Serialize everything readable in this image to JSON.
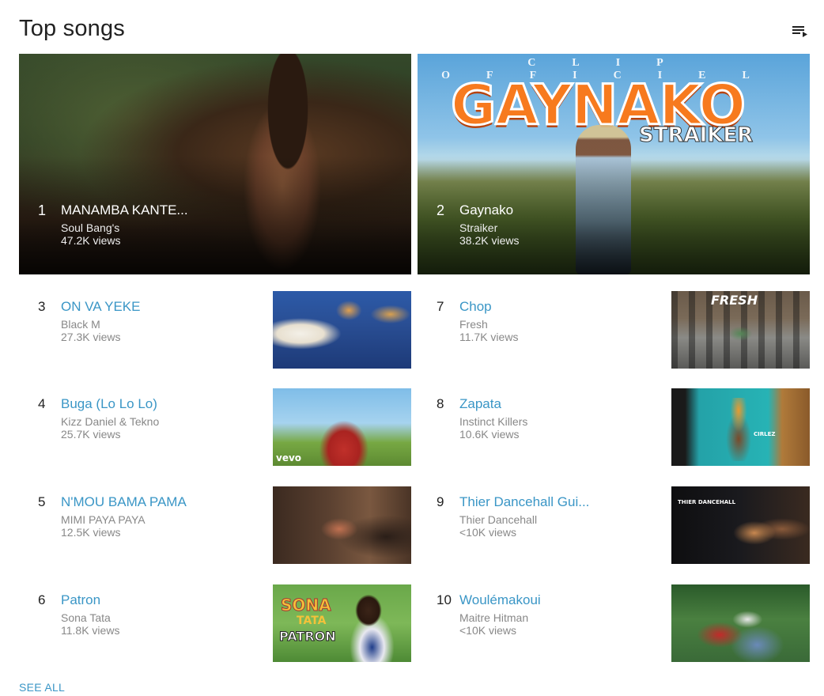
{
  "section": {
    "title": "Top songs",
    "queue_icon": "playlist-play-icon",
    "see_all": "SEE ALL"
  },
  "featured": [
    {
      "rank": "1",
      "title": "MANAMBA KANTE...",
      "artist": "Soul Bang's",
      "views": "47.2K views"
    },
    {
      "rank": "2",
      "title": "Gaynako",
      "artist": "Straiker",
      "views": "38.2K views",
      "thumb_text": {
        "top": "CLIP OFFICIEL",
        "logo": "GAYNAKO",
        "sub": "STRAIKER"
      }
    }
  ],
  "songs": [
    {
      "rank": "3",
      "title": "ON VA YEKE",
      "artist": "Black M",
      "views": "27.3K views"
    },
    {
      "rank": "4",
      "title": "Buga (Lo Lo Lo)",
      "artist": "Kizz Daniel & Tekno",
      "views": "25.7K views",
      "thumb_text": "vevo"
    },
    {
      "rank": "5",
      "title": "N'MOU BAMA PAMA",
      "artist": "MIMI PAYA PAYA",
      "views": "12.5K views"
    },
    {
      "rank": "6",
      "title": "Patron",
      "artist": "Sona Tata",
      "views": "11.8K views",
      "thumb_text": {
        "a": "SONA",
        "b": "TATA",
        "c": "PATRON"
      }
    },
    {
      "rank": "7",
      "title": "Chop",
      "artist": "Fresh",
      "views": "11.7K views",
      "thumb_text": "FRESH"
    },
    {
      "rank": "8",
      "title": "Zapata",
      "artist": "Instinct Killers",
      "views": "10.6K views",
      "thumb_text": "CIRLEZ"
    },
    {
      "rank": "9",
      "title": "Thier Dancehall Gui...",
      "artist": "Thier Dancehall",
      "views": "<10K views",
      "thumb_text": "THIER DANCEHALL"
    },
    {
      "rank": "10",
      "title": "Woulémakoui",
      "artist": "Maitre Hitman",
      "views": "<10K views"
    }
  ],
  "colors": {
    "link": "#3a96c6",
    "secondary": "#888888",
    "accent_logo": "#f77a1e"
  }
}
